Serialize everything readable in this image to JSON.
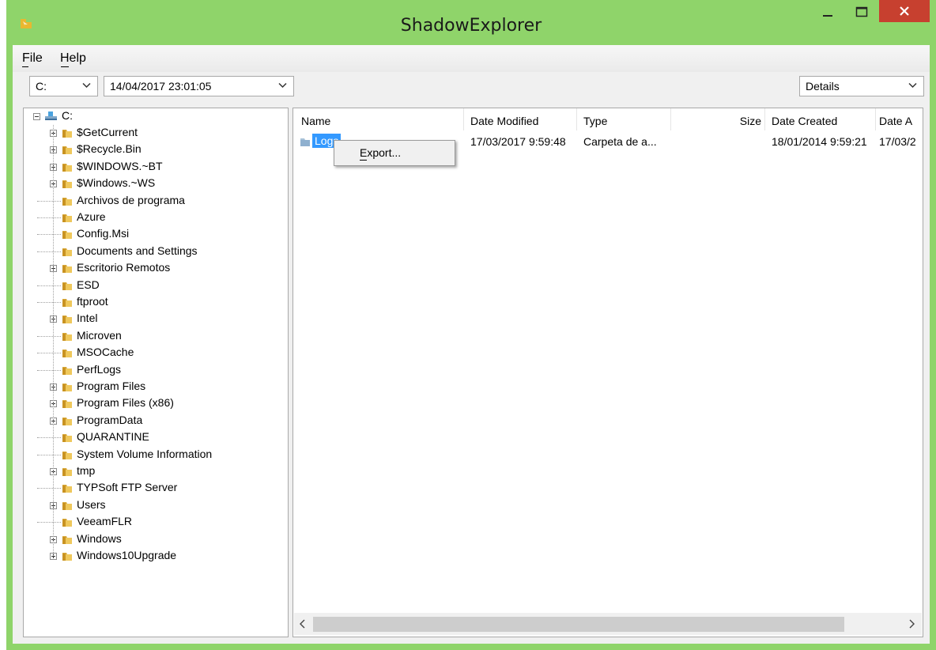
{
  "window": {
    "title": "ShadowExplorer"
  },
  "menu": {
    "file": "File",
    "help": "Help"
  },
  "toolbar": {
    "drive": "C:",
    "snapshot": "14/04/2017 23:01:05",
    "view": "Details"
  },
  "tree": {
    "root": "C:",
    "items": [
      {
        "label": "$GetCurrent",
        "expandable": true
      },
      {
        "label": "$Recycle.Bin",
        "expandable": true
      },
      {
        "label": "$WINDOWS.~BT",
        "expandable": true
      },
      {
        "label": "$Windows.~WS",
        "expandable": true
      },
      {
        "label": "Archivos de programa",
        "expandable": false
      },
      {
        "label": "Azure",
        "expandable": false
      },
      {
        "label": "Config.Msi",
        "expandable": false
      },
      {
        "label": "Documents and Settings",
        "expandable": false
      },
      {
        "label": "Escritorio Remotos",
        "expandable": true
      },
      {
        "label": "ESD",
        "expandable": false
      },
      {
        "label": "ftproot",
        "expandable": false
      },
      {
        "label": "Intel",
        "expandable": true
      },
      {
        "label": "Microven",
        "expandable": false
      },
      {
        "label": "MSOCache",
        "expandable": false
      },
      {
        "label": "PerfLogs",
        "expandable": false
      },
      {
        "label": "Program Files",
        "expandable": true
      },
      {
        "label": "Program Files (x86)",
        "expandable": true
      },
      {
        "label": "ProgramData",
        "expandable": true
      },
      {
        "label": "QUARANTINE",
        "expandable": false
      },
      {
        "label": "System Volume Information",
        "expandable": false
      },
      {
        "label": "tmp",
        "expandable": true
      },
      {
        "label": "TYPSoft FTP Server",
        "expandable": false
      },
      {
        "label": "Users",
        "expandable": true
      },
      {
        "label": "VeeamFLR",
        "expandable": false
      },
      {
        "label": "Windows",
        "expandable": true
      },
      {
        "label": "Windows10Upgrade",
        "expandable": true
      }
    ]
  },
  "list": {
    "columns": {
      "name": "Name",
      "modified": "Date Modified",
      "type": "Type",
      "size": "Size",
      "created": "Date Created",
      "accessed": "Date A"
    },
    "row": {
      "name": "Logs",
      "modified": "17/03/2017 9:59:48",
      "type": "Carpeta de a...",
      "size": "",
      "created": "18/01/2014 9:59:21",
      "accessed": "17/03/2"
    }
  },
  "context_menu": {
    "export": "Export..."
  },
  "colors": {
    "frame": "#8fd46a",
    "close": "#c7402f",
    "selection": "#3399ff",
    "folder": "#e8c15a"
  }
}
